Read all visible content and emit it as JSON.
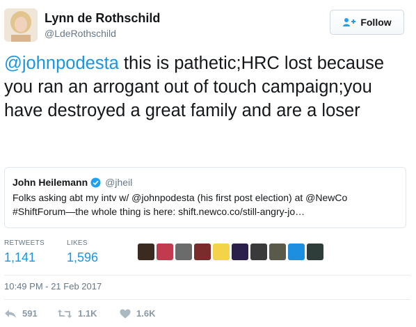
{
  "header": {
    "name": "Lynn de Rothschild",
    "handle": "@LdeRothschild",
    "follow_label": "Follow"
  },
  "tweet": {
    "mention": "@johnpodesta",
    "text": " this is pathetic;HRC lost because you ran an arrogant out of touch campaign;you have destroyed a great family and are a loser"
  },
  "quote": {
    "name": "John Heilemann",
    "handle": "@jheil",
    "text": "Folks asking abt my intv w/ @johnpodesta (his first post election) at @NewCo #ShiftForum—the whole thing is here: shift.newco.co/still-angry-jo…"
  },
  "stats": {
    "retweets_label": "RETWEETS",
    "retweets": "1,141",
    "likes_label": "LIKES",
    "likes": "1,596"
  },
  "likers": [
    {
      "color": "#3a2a1f"
    },
    {
      "color": "#c23a4e"
    },
    {
      "color": "#6b6b6b"
    },
    {
      "color": "#7a2b2b"
    },
    {
      "color": "#f3d34a"
    },
    {
      "color": "#2a1f4a"
    },
    {
      "color": "#3a3a3a"
    },
    {
      "color": "#5a5a4a"
    },
    {
      "color": "#1d8fe0"
    },
    {
      "color": "#2f3d3a"
    }
  ],
  "timestamp": "10:49 PM - 21 Feb 2017",
  "actions": {
    "reply_count": "591",
    "retweet_count": "1.1K",
    "like_count": "1.6K"
  }
}
